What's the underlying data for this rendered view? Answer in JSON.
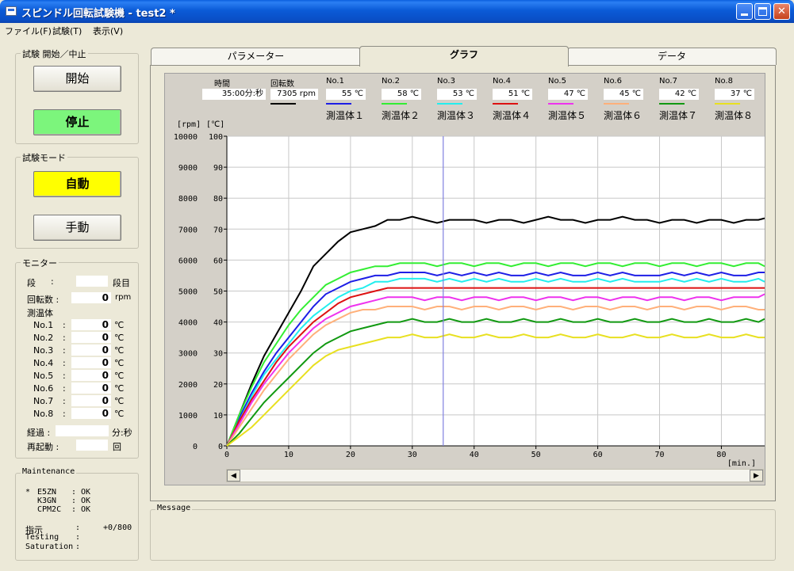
{
  "window": {
    "title": "スピンドル回転試験機 - test2 *"
  },
  "menu": [
    "ファイル(F)",
    "試験(T)",
    "表示(V)"
  ],
  "test_control": {
    "title": "試験 開始／中止",
    "start_label": "開始",
    "stop_label": "停止"
  },
  "mode": {
    "title": "試験モード",
    "auto_label": "自動",
    "manual_label": "手動"
  },
  "monitor": {
    "title": "モニター",
    "stage_label": "段",
    "colon": ":",
    "stage_value": "",
    "stage_unit": "段目",
    "rpm_label": "回転数 :",
    "rpm_value": "0",
    "rpm_unit": "rpm",
    "temp_label": "測温体",
    "sensors": [
      {
        "label": "No.1",
        "value": "0",
        "unit": "℃"
      },
      {
        "label": "No.2",
        "value": "0",
        "unit": "℃"
      },
      {
        "label": "No.3",
        "value": "0",
        "unit": "℃"
      },
      {
        "label": "No.4",
        "value": "0",
        "unit": "℃"
      },
      {
        "label": "No.5",
        "value": "0",
        "unit": "℃"
      },
      {
        "label": "No.6",
        "value": "0",
        "unit": "℃"
      },
      {
        "label": "No.7",
        "value": "0",
        "unit": "℃"
      },
      {
        "label": "No.8",
        "value": "0",
        "unit": "℃"
      }
    ],
    "elapsed_label": "経過 :",
    "elapsed_value": "",
    "elapsed_unit": "分:秒",
    "restart_label": "再起動 :",
    "restart_value": "",
    "restart_unit": "回"
  },
  "maintenance": {
    "title": "Maintenance",
    "marker": "*",
    "items": [
      {
        "name": "E5ZN",
        "status": ": OK"
      },
      {
        "name": "K3GN",
        "status": ": OK"
      },
      {
        "name": "CPM2C",
        "status": ": OK"
      }
    ],
    "rows": [
      {
        "label": "指示",
        "colon": ":",
        "value": "+0/800"
      },
      {
        "label": "Testing",
        "colon": ":",
        "value": ""
      },
      {
        "label": "Saturation",
        "colon": ":",
        "value": ""
      }
    ]
  },
  "tabs": [
    "パラメーター",
    "グラフ",
    "データ"
  ],
  "message": {
    "title": "Message"
  },
  "graph_header": {
    "time_label": "時間",
    "time_value": "35:00分:秒",
    "rpm_label": "回転数",
    "rpm_value": "7305 rpm",
    "rpm_color": "#000000",
    "sensors": [
      {
        "label": "No.1",
        "value": "55 ℃",
        "color": "#1e1ee6",
        "name": "測温体１"
      },
      {
        "label": "No.2",
        "value": "58 ℃",
        "color": "#33ee33",
        "name": "測温体２"
      },
      {
        "label": "No.3",
        "value": "53 ℃",
        "color": "#22eeee",
        "name": "測温体３"
      },
      {
        "label": "No.4",
        "value": "51 ℃",
        "color": "#dd1111",
        "name": "測温体４"
      },
      {
        "label": "No.5",
        "value": "47 ℃",
        "color": "#ee33ee",
        "name": "測温体５"
      },
      {
        "label": "No.6",
        "value": "45 ℃",
        "color": "#ffb07a",
        "name": "測温体６"
      },
      {
        "label": "No.7",
        "value": "42 ℃",
        "color": "#119911",
        "name": "測温体７"
      },
      {
        "label": "No.8",
        "value": "37 ℃",
        "color": "#e8e020",
        "name": "測温体８"
      }
    ]
  },
  "chart_data": {
    "type": "line",
    "xlabel": "[min.]",
    "ylabel_left": "[rpm]",
    "ylabel_right": "[℃]",
    "xlim": [
      0,
      87
    ],
    "ylim_rpm": [
      0,
      10000
    ],
    "ylim_temp": [
      0,
      100
    ],
    "x_ticks": [
      0,
      10,
      20,
      30,
      40,
      50,
      60,
      70,
      80
    ],
    "y_ticks_rpm": [
      0,
      1000,
      2000,
      3000,
      4000,
      5000,
      6000,
      7000,
      8000,
      9000,
      10000
    ],
    "y_ticks_temp": [
      0,
      10,
      20,
      30,
      40,
      50,
      60,
      70,
      80,
      90,
      100
    ],
    "grid": true,
    "cursor_x": 35,
    "x": [
      0,
      2,
      4,
      6,
      8,
      10,
      12,
      14,
      16,
      18,
      20,
      22,
      24,
      26,
      28,
      30,
      32,
      34,
      36,
      38,
      40,
      42,
      44,
      46,
      48,
      50,
      52,
      54,
      56,
      58,
      60,
      62,
      64,
      66,
      68,
      70,
      72,
      74,
      76,
      78,
      80,
      82,
      84,
      86,
      87
    ],
    "series": [
      {
        "name": "回転数",
        "color": "#000000",
        "axis": "rpm",
        "values": [
          0,
          1000,
          2000,
          2900,
          3600,
          4300,
          5000,
          5800,
          6200,
          6600,
          6900,
          7000,
          7100,
          7300,
          7300,
          7400,
          7300,
          7200,
          7300,
          7300,
          7300,
          7200,
          7300,
          7300,
          7200,
          7300,
          7400,
          7300,
          7300,
          7200,
          7300,
          7300,
          7400,
          7300,
          7300,
          7200,
          7300,
          7300,
          7200,
          7300,
          7300,
          7200,
          7300,
          7300,
          7350
        ]
      },
      {
        "name": "測温体１",
        "color": "#1e1ee6",
        "axis": "temp",
        "values": [
          0,
          9,
          17,
          24,
          30,
          35,
          40,
          45,
          49,
          51,
          53,
          54,
          55,
          55,
          56,
          56,
          56,
          55,
          56,
          55,
          56,
          55,
          56,
          55,
          55,
          56,
          55,
          56,
          55,
          55,
          56,
          55,
          56,
          55,
          55,
          55,
          56,
          55,
          56,
          55,
          56,
          55,
          55,
          56,
          56
        ]
      },
      {
        "name": "測温体２",
        "color": "#33ee33",
        "axis": "temp",
        "values": [
          0,
          10,
          19,
          27,
          33,
          39,
          44,
          48,
          52,
          54,
          56,
          57,
          58,
          58,
          59,
          59,
          59,
          58,
          59,
          59,
          58,
          59,
          59,
          58,
          59,
          59,
          58,
          59,
          59,
          58,
          59,
          59,
          58,
          59,
          59,
          58,
          59,
          59,
          58,
          59,
          59,
          58,
          59,
          59,
          58
        ]
      },
      {
        "name": "測温体３",
        "color": "#22eeee",
        "axis": "temp",
        "values": [
          0,
          8,
          16,
          23,
          28,
          33,
          38,
          42,
          45,
          48,
          50,
          51,
          53,
          53,
          54,
          54,
          54,
          53,
          54,
          53,
          54,
          53,
          54,
          53,
          53,
          54,
          53,
          54,
          53,
          53,
          54,
          53,
          54,
          53,
          53,
          53,
          54,
          53,
          54,
          53,
          54,
          53,
          53,
          54,
          53
        ]
      },
      {
        "name": "測温体４",
        "color": "#dd1111",
        "axis": "temp",
        "values": [
          0,
          8,
          15,
          21,
          27,
          32,
          36,
          40,
          43,
          46,
          48,
          49,
          50,
          51,
          51,
          51,
          51,
          51,
          51,
          51,
          51,
          51,
          51,
          51,
          51,
          51,
          51,
          51,
          51,
          51,
          51,
          51,
          51,
          51,
          51,
          51,
          51,
          51,
          51,
          51,
          51,
          51,
          51,
          51,
          51
        ]
      },
      {
        "name": "測温体５",
        "color": "#ee33ee",
        "axis": "temp",
        "values": [
          0,
          7,
          14,
          20,
          25,
          30,
          34,
          38,
          41,
          43,
          45,
          46,
          47,
          48,
          48,
          48,
          47,
          48,
          48,
          47,
          48,
          48,
          47,
          48,
          48,
          47,
          48,
          48,
          47,
          48,
          48,
          47,
          48,
          48,
          47,
          48,
          48,
          47,
          48,
          48,
          47,
          48,
          48,
          48,
          49
        ]
      },
      {
        "name": "測温体６",
        "color": "#ffb07a",
        "axis": "temp",
        "values": [
          0,
          6,
          12,
          18,
          23,
          28,
          32,
          36,
          39,
          41,
          43,
          44,
          44,
          45,
          45,
          45,
          44,
          45,
          45,
          44,
          45,
          45,
          44,
          45,
          45,
          44,
          45,
          45,
          44,
          45,
          45,
          44,
          45,
          45,
          44,
          45,
          45,
          44,
          45,
          45,
          44,
          45,
          45,
          44,
          44
        ]
      },
      {
        "name": "測温体７",
        "color": "#119911",
        "axis": "temp",
        "values": [
          0,
          4,
          9,
          14,
          18,
          22,
          26,
          30,
          33,
          35,
          37,
          38,
          39,
          40,
          40,
          41,
          40,
          40,
          41,
          40,
          40,
          41,
          40,
          40,
          41,
          40,
          40,
          41,
          40,
          40,
          41,
          40,
          40,
          41,
          40,
          40,
          41,
          40,
          40,
          41,
          40,
          40,
          41,
          40,
          41
        ]
      },
      {
        "name": "測温体８",
        "color": "#e8e020",
        "axis": "temp",
        "values": [
          0,
          3,
          6,
          10,
          14,
          18,
          22,
          26,
          29,
          31,
          32,
          33,
          34,
          35,
          35,
          36,
          35,
          35,
          36,
          35,
          35,
          36,
          35,
          35,
          36,
          35,
          35,
          36,
          35,
          35,
          36,
          35,
          35,
          36,
          35,
          35,
          36,
          35,
          35,
          36,
          35,
          35,
          36,
          35,
          35
        ]
      }
    ]
  }
}
